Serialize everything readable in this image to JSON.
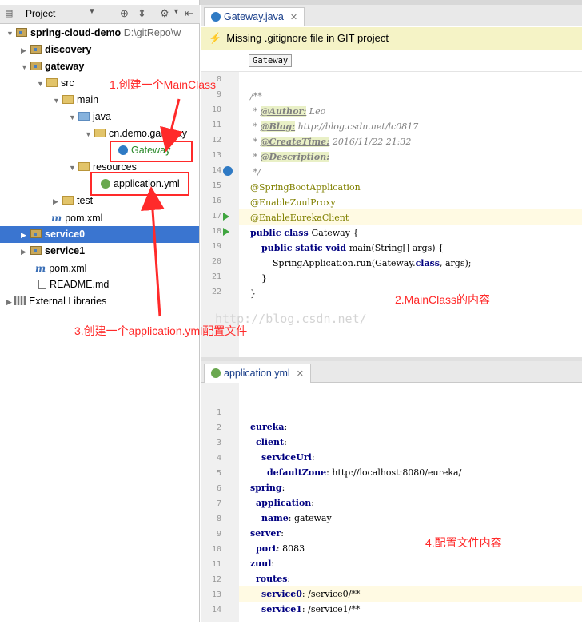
{
  "project_panel": {
    "title": "Project",
    "tree": [
      {
        "label": "spring-cloud-demo",
        "path": "D:\\gitRepo\\w"
      },
      {
        "label": "discovery"
      },
      {
        "label": "gateway"
      },
      {
        "label": "src"
      },
      {
        "label": "main"
      },
      {
        "label": "java"
      },
      {
        "label": "cn.demo.gateway"
      },
      {
        "label": "Gateway"
      },
      {
        "label": "resources"
      },
      {
        "label": "application.yml"
      },
      {
        "label": "test"
      },
      {
        "label": "pom.xml"
      },
      {
        "label": "service0"
      },
      {
        "label": "service1"
      },
      {
        "label": "pom.xml"
      },
      {
        "label": "README.md"
      },
      {
        "label": "External Libraries"
      }
    ]
  },
  "annotations": {
    "a1": "1.创建一个MainClass",
    "a2": "2.MainClass的内容",
    "a3": "3.创建一个application.yml配置文件",
    "a4": "4.配置文件内容"
  },
  "editor_top": {
    "tab": "Gateway.java",
    "banner": "Missing .gitignore file in GIT project",
    "breadcrumb": "Gateway",
    "watermark": "http://blog.csdn.net/",
    "line_numbers": [
      "8",
      "9",
      "10",
      "11",
      "12",
      "13",
      "14",
      "15",
      "16",
      "17",
      "18",
      "19",
      "20",
      "21",
      "22"
    ],
    "code": {
      "l8": "/**",
      "author_tag": "@Author:",
      "author_val": " Leo",
      "blog_tag": "@Blog:",
      "blog_val": " http://blog.csdn.net/lc0817",
      "ct_tag": "@CreateTime:",
      "ct_val": " 2016/11/22 21:32",
      "desc_tag": "@Description:",
      "l13": " */",
      "l14": "@SpringBootApplication",
      "l15": "@EnableZuulProxy",
      "l16": "@EnableEurekaClient",
      "l17_kw": "public class ",
      "l17_rest": "Gateway {",
      "l18_kw": "public static void ",
      "l18_rest": "main(String[] args) {",
      "l19_a": "SpringApplication.run(Gateway.",
      "l19_kw": "class",
      "l19_b": ", args);",
      "l20": "}",
      "l21": "}"
    }
  },
  "editor_bottom": {
    "tab": "application.yml",
    "line_numbers": [
      "1",
      "2",
      "3",
      "4",
      "5",
      "6",
      "7",
      "8",
      "9",
      "10",
      "11",
      "12",
      "13",
      "14"
    ],
    "yaml": [
      {
        "k": "eureka",
        "v": ""
      },
      {
        "k": "client",
        "v": ""
      },
      {
        "k": "serviceUrl",
        "v": ""
      },
      {
        "k": "defaultZone",
        "v": " http://localhost:8080/eureka/"
      },
      {
        "k": "spring",
        "v": ""
      },
      {
        "k": "application",
        "v": ""
      },
      {
        "k": "name",
        "v": " gateway"
      },
      {
        "k": "server",
        "v": ""
      },
      {
        "k": "port",
        "v": " 8083"
      },
      {
        "k": "zuul",
        "v": ""
      },
      {
        "k": "routes",
        "v": ""
      },
      {
        "k": "service0",
        "v": " /service0/**"
      },
      {
        "k": "service1",
        "v": " /service1/**"
      }
    ]
  }
}
